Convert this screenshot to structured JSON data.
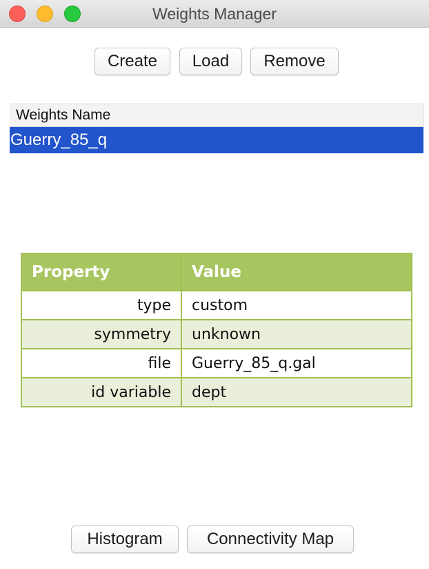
{
  "window": {
    "title": "Weights Manager"
  },
  "toolbar": {
    "create_label": "Create",
    "load_label": "Load",
    "remove_label": "Remove"
  },
  "weights_list": {
    "header": "Weights Name",
    "items": [
      {
        "name": "Guerry_85_q",
        "selected": true
      }
    ]
  },
  "properties_table": {
    "headers": {
      "property": "Property",
      "value": "Value"
    },
    "rows": [
      {
        "property": "type",
        "value": "custom"
      },
      {
        "property": "symmetry",
        "value": "unknown"
      },
      {
        "property": "file",
        "value": "Guerry_85_q.gal"
      },
      {
        "property": "id variable",
        "value": "dept"
      }
    ]
  },
  "bottom_buttons": {
    "histogram_label": "Histogram",
    "connectivity_label": "Connectivity Map"
  },
  "colors": {
    "selection": "#2254cc",
    "table_header": "#a8c660",
    "table_border": "#a1c051",
    "table_alt_row": "#e9efd8"
  }
}
